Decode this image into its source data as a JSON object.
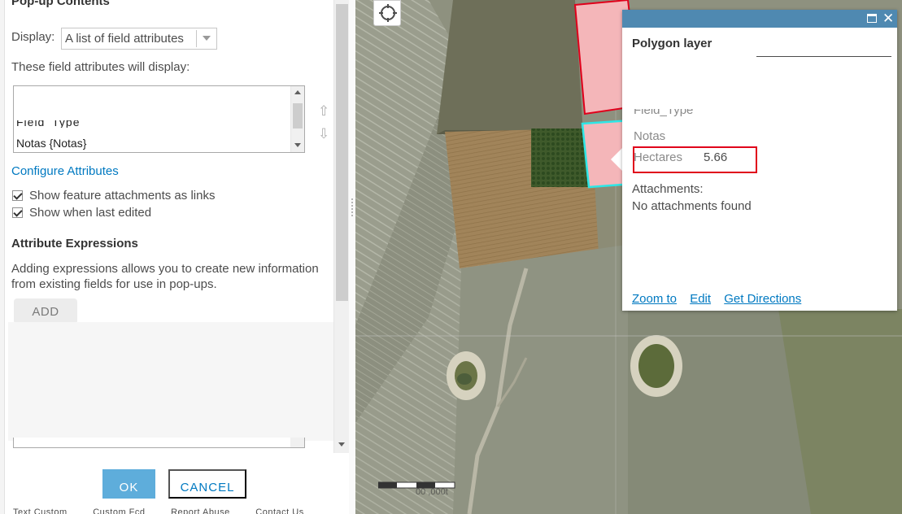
{
  "left_panel": {
    "title": "Pop-up Contents",
    "display_label": "Display:",
    "display_value": "A list of field attributes",
    "fields_caption": "These field attributes will display:",
    "field_list": {
      "partial_item": "Field_Type",
      "visible_item": "Notas {Notas}"
    },
    "order_up_glyph": "⇧",
    "order_down_glyph": "⇩",
    "configure_link": "Configure Attributes",
    "checkboxes": {
      "attachments": "Show feature attachments as links",
      "last_edited": "Show when last edited"
    },
    "expressions_title": "Attribute Expressions",
    "expressions_desc": "Adding expressions allows you to create new information from existing fields for use in pop-ups.",
    "add_label": "ADD",
    "ok_label": "OK",
    "cancel_label": "CANCEL",
    "footer": [
      "Text Custom",
      "Custom Fcd",
      "Report Abuse",
      "Contact Us"
    ]
  },
  "map": {
    "locate_icon": "crosshair-icon",
    "scale_text": "00   ,000t"
  },
  "popup": {
    "title": "Polygon layer",
    "clipped_field": "Field_Type",
    "field_notas": "Notas",
    "field_hectares_label": "Hectares",
    "field_hectares_value": "5.66",
    "attachments_label": "Attachments:",
    "attachments_value": "No attachments found",
    "links": {
      "zoom": "Zoom to",
      "edit": "Edit",
      "directions": "Get Directions"
    },
    "close_glyph": "✕"
  },
  "colors": {
    "header_blue": "#4f89b1",
    "link_blue": "#0079c1",
    "ok_blue": "#5eaddb",
    "highlight_red": "#e0001b",
    "polygon_fill": "#f4b6b9",
    "selected_outline": "#2ee6e6"
  }
}
